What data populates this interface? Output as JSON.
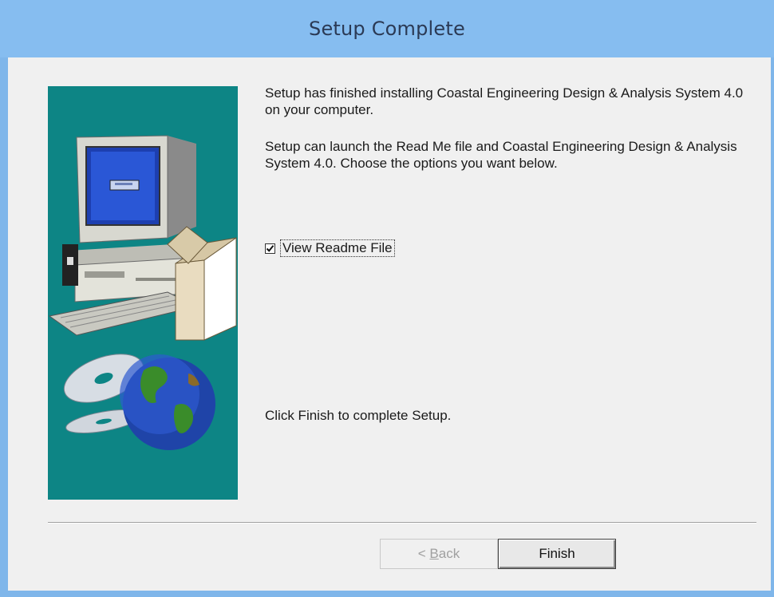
{
  "window": {
    "title": "Setup Complete"
  },
  "content": {
    "paragraph1": "Setup has finished installing Coastal Engineering Design & Analysis System 4.0 on your computer.",
    "paragraph2": "Setup can launch the Read Me file and Coastal Engineering Design & Analysis System 4.0.  Choose the options you want below.",
    "checkbox": {
      "label": "View Readme File",
      "checked": true
    },
    "paragraph3": "Click Finish to complete Setup."
  },
  "buttons": {
    "back_prefix": "< ",
    "back_mnemonic": "B",
    "back_rest": "ack",
    "finish": "Finish"
  },
  "colors": {
    "titlebar": "#86bdf0",
    "panel": "#0d8585",
    "client": "#f0f0f0"
  },
  "icons": [
    "computer-icon",
    "cd-discs-icon",
    "globe-icon",
    "checkmark-icon"
  ]
}
